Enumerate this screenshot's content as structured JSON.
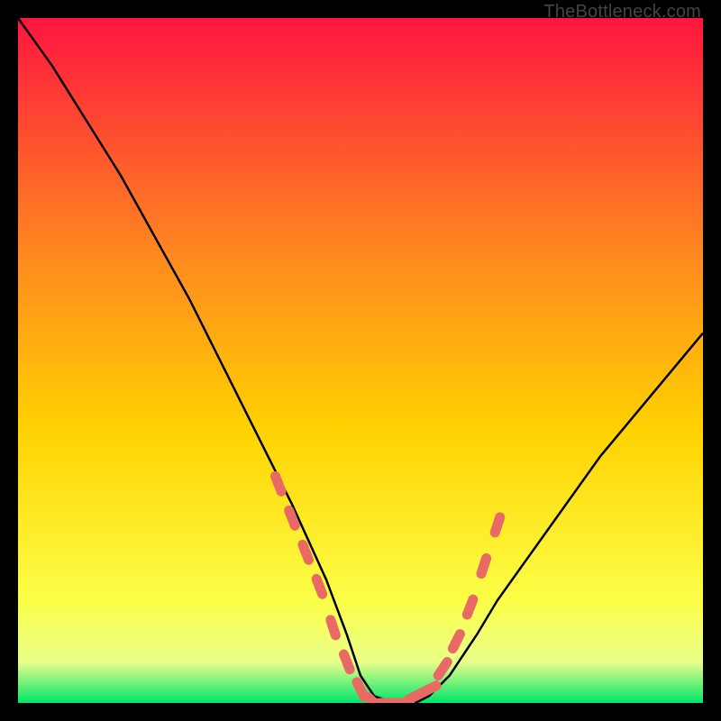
{
  "watermark": "TheBottleneck.com",
  "colors": {
    "gradient_top": "#ff153f",
    "gradient_mid1": "#ff6e2a",
    "gradient_mid2": "#ffd200",
    "gradient_mid3": "#fff700",
    "gradient_bottom": "#00e56a",
    "curve": "#000000",
    "marker": "#e96a64",
    "frame_bg": "#000000"
  },
  "chart_data": {
    "type": "line",
    "title": "",
    "xlabel": "",
    "ylabel": "",
    "xlim": [
      0,
      100
    ],
    "ylim": [
      0,
      100
    ],
    "series": [
      {
        "name": "bottleneck-curve",
        "x": [
          0,
          5,
          10,
          15,
          20,
          25,
          30,
          35,
          40,
          45,
          48,
          50,
          52,
          55,
          58,
          60,
          63,
          67,
          70,
          75,
          80,
          85,
          90,
          95,
          100
        ],
        "y": [
          100,
          93,
          85,
          77,
          68,
          59,
          49,
          39,
          29,
          18,
          10,
          4,
          1,
          0,
          0,
          1,
          4,
          10,
          15,
          22,
          29,
          36,
          42,
          48,
          54
        ]
      }
    ],
    "markers": {
      "name": "highlight-dots",
      "x": [
        38,
        40,
        42,
        44,
        46,
        48,
        50,
        52,
        54,
        56,
        58,
        60,
        62,
        64,
        66,
        68,
        70
      ],
      "y": [
        32,
        27,
        22,
        17,
        11,
        6,
        2,
        0,
        0,
        0,
        1,
        2,
        5,
        9,
        14,
        20,
        26
      ]
    }
  }
}
